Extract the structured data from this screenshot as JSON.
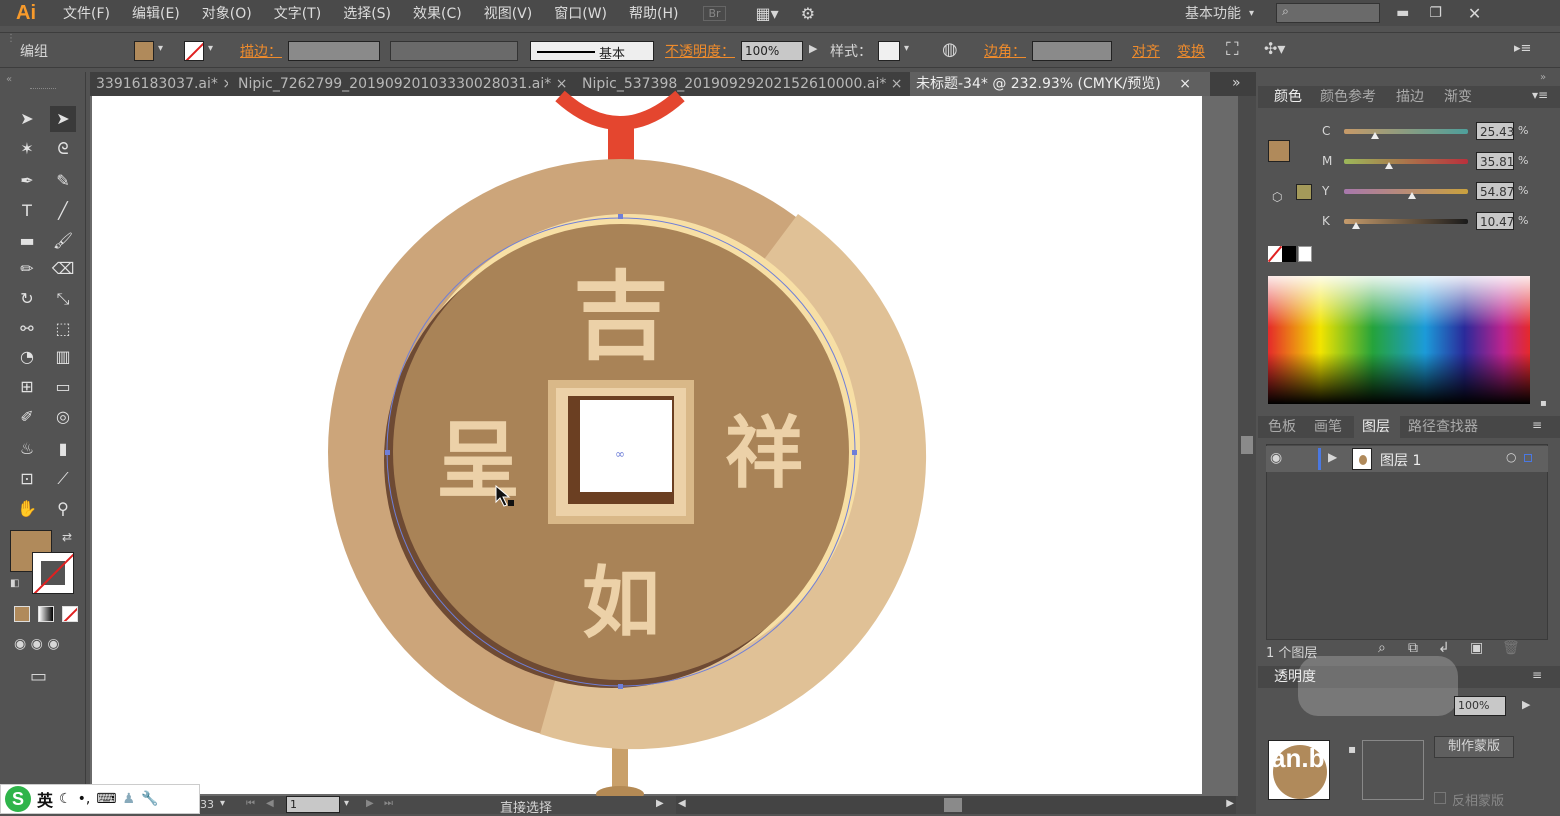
{
  "app": {
    "logo": "Ai"
  },
  "menu": [
    "文件(F)",
    "编辑(E)",
    "对象(O)",
    "文字(T)",
    "选择(S)",
    "效果(C)",
    "视图(V)",
    "窗口(W)",
    "帮助(H)"
  ],
  "menu_extra": {
    "br": "Br",
    "workspace": "基本功能"
  },
  "control": {
    "group_label": "编组",
    "stroke_label": "描边：",
    "brush_style": "基本",
    "opacity_label": "不透明度：",
    "opacity_value": "100%",
    "style_label": "样式：",
    "corner_label": "边角：",
    "align_label": "对齐",
    "transform_label": "变换"
  },
  "tabs": [
    {
      "label": "33916183037.ai*"
    },
    {
      "label": "Nipic_7262799_20190920103330028031.ai*"
    },
    {
      "label": "Nipic_537398_20190929202152610000.ai*"
    },
    {
      "label": "未标题-34* @ 232.93% (CMYK/预览)"
    }
  ],
  "coin": {
    "char_top": "吉",
    "char_left": "呈",
    "char_right": "祥",
    "char_bottom": "如"
  },
  "color_panel": {
    "tabs": [
      "颜色",
      "颜色参考",
      "描边",
      "渐变"
    ],
    "channels": [
      {
        "name": "C",
        "value": "25.43",
        "unit": "%",
        "level": 0.25
      },
      {
        "name": "M",
        "value": "35.81",
        "unit": "%",
        "level": 0.36
      },
      {
        "name": "Y",
        "value": "54.87",
        "unit": "%",
        "level": 0.55
      },
      {
        "name": "K",
        "value": "10.47",
        "unit": "%",
        "level": 0.1
      }
    ],
    "fill_color": "#b08a5b"
  },
  "layers_panel": {
    "tabs": [
      "色板",
      "画笔",
      "图层",
      "路径查找器"
    ],
    "layer_name": "图层 1",
    "count": "1 个图层"
  },
  "transparency_panel": {
    "title": "透明度",
    "opacity": "100%",
    "make_mask": "制作蒙版",
    "invert_mask": "反相蒙版",
    "watermark": "an.b"
  },
  "status": {
    "page": "1",
    "zoom": "33",
    "tool_name": "直接选择"
  },
  "ime": {
    "lang": "英"
  }
}
